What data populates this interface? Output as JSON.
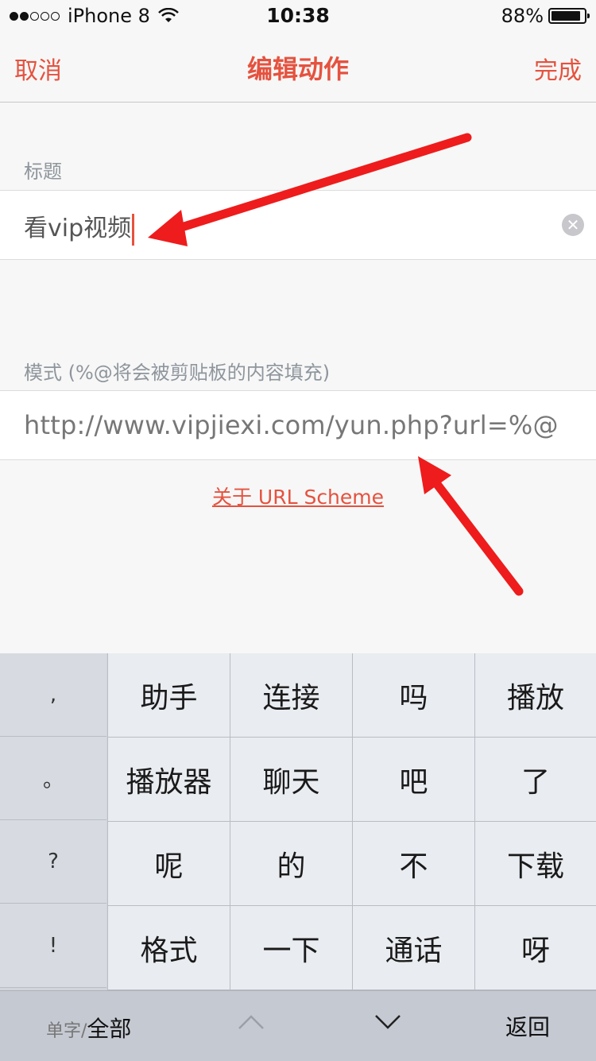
{
  "status": {
    "carrier": "iPhone 8",
    "time": "10:38",
    "battery": "88%",
    "battery_level": 0.88
  },
  "nav": {
    "cancel": "取消",
    "title": "编辑动作",
    "done": "完成"
  },
  "title_section": {
    "label": "标题",
    "value": "看vip视频"
  },
  "mode_section": {
    "label": "模式 (%@将会被剪贴板的内容填充)",
    "value": "http://www.vipjiexi.com/yun.php?url=%@"
  },
  "link": "关于 URL Scheme",
  "keyboard": {
    "punctuation": [
      ",",
      "。",
      "?",
      "!"
    ],
    "candidates": [
      "助手",
      "连接",
      "吗",
      "播放",
      "播放器",
      "聊天",
      "吧",
      "了",
      "呢",
      "的",
      "不",
      "下载",
      "格式",
      "一下",
      "通话",
      "呀"
    ],
    "mode_single": "单字/",
    "mode_all": "全部",
    "return": "返回"
  },
  "colors": {
    "accent": "#e5523f",
    "annotation_arrow": "#ee1c1c"
  }
}
